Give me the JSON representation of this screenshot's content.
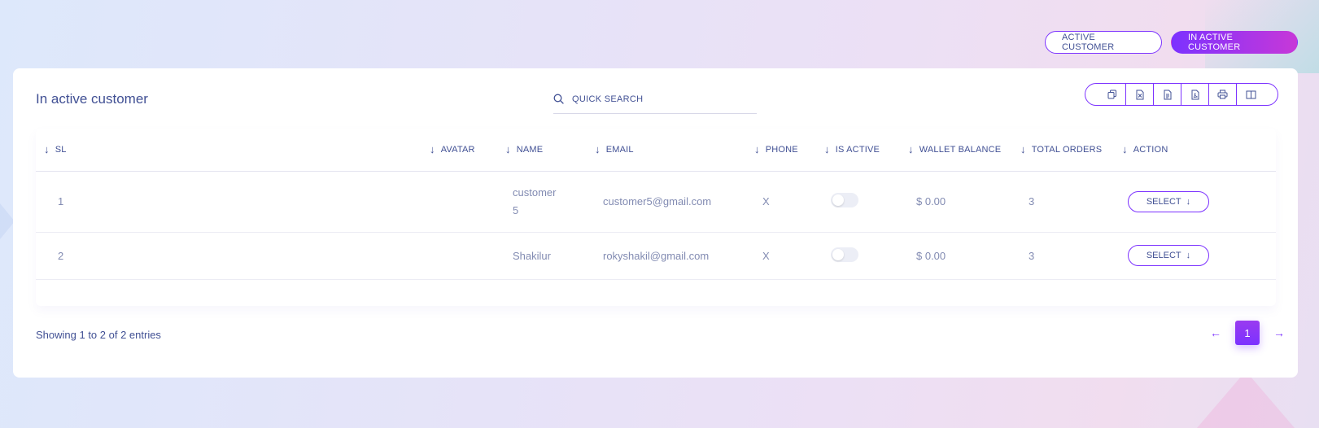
{
  "colors": {
    "accent": "#7c32ff",
    "accent_end": "#c738d8",
    "text": "#415094",
    "muted": "#828bb2"
  },
  "top_buttons": {
    "active_label": "ACTIVE CUSTOMER",
    "inactive_label": "IN ACTIVE CUSTOMER"
  },
  "card": {
    "title": "In active customer",
    "search": {
      "placeholder": "QUICK SEARCH",
      "icon": "search-icon"
    },
    "export_buttons": [
      {
        "name": "copy-icon"
      },
      {
        "name": "excel-icon"
      },
      {
        "name": "csv-icon"
      },
      {
        "name": "pdf-icon"
      },
      {
        "name": "print-icon"
      },
      {
        "name": "columns-icon"
      }
    ]
  },
  "table": {
    "headers": [
      "SL",
      "AVATAR",
      "NAME",
      "EMAIL",
      "PHONE",
      "IS ACTIVE",
      "WALLET BALANCE",
      "TOTAL ORDERS",
      "ACTION"
    ],
    "rows": [
      {
        "sl": "1",
        "name_line1": "customer",
        "name_line2": "5",
        "email": "customer5@gmail.com",
        "phone": "X",
        "is_active": false,
        "wallet": "$ 0.00",
        "orders": "3",
        "action": "SELECT"
      },
      {
        "sl": "2",
        "name_line1": "Shakilur",
        "name_line2": "",
        "email": "rokyshakil@gmail.com",
        "phone": "X",
        "is_active": false,
        "wallet": "$ 0.00",
        "orders": "3",
        "action": "SELECT"
      }
    ]
  },
  "footer": {
    "info": "Showing 1 to 2 of 2 entries",
    "current_page": "1",
    "prev_label": "←",
    "next_label": "→"
  }
}
